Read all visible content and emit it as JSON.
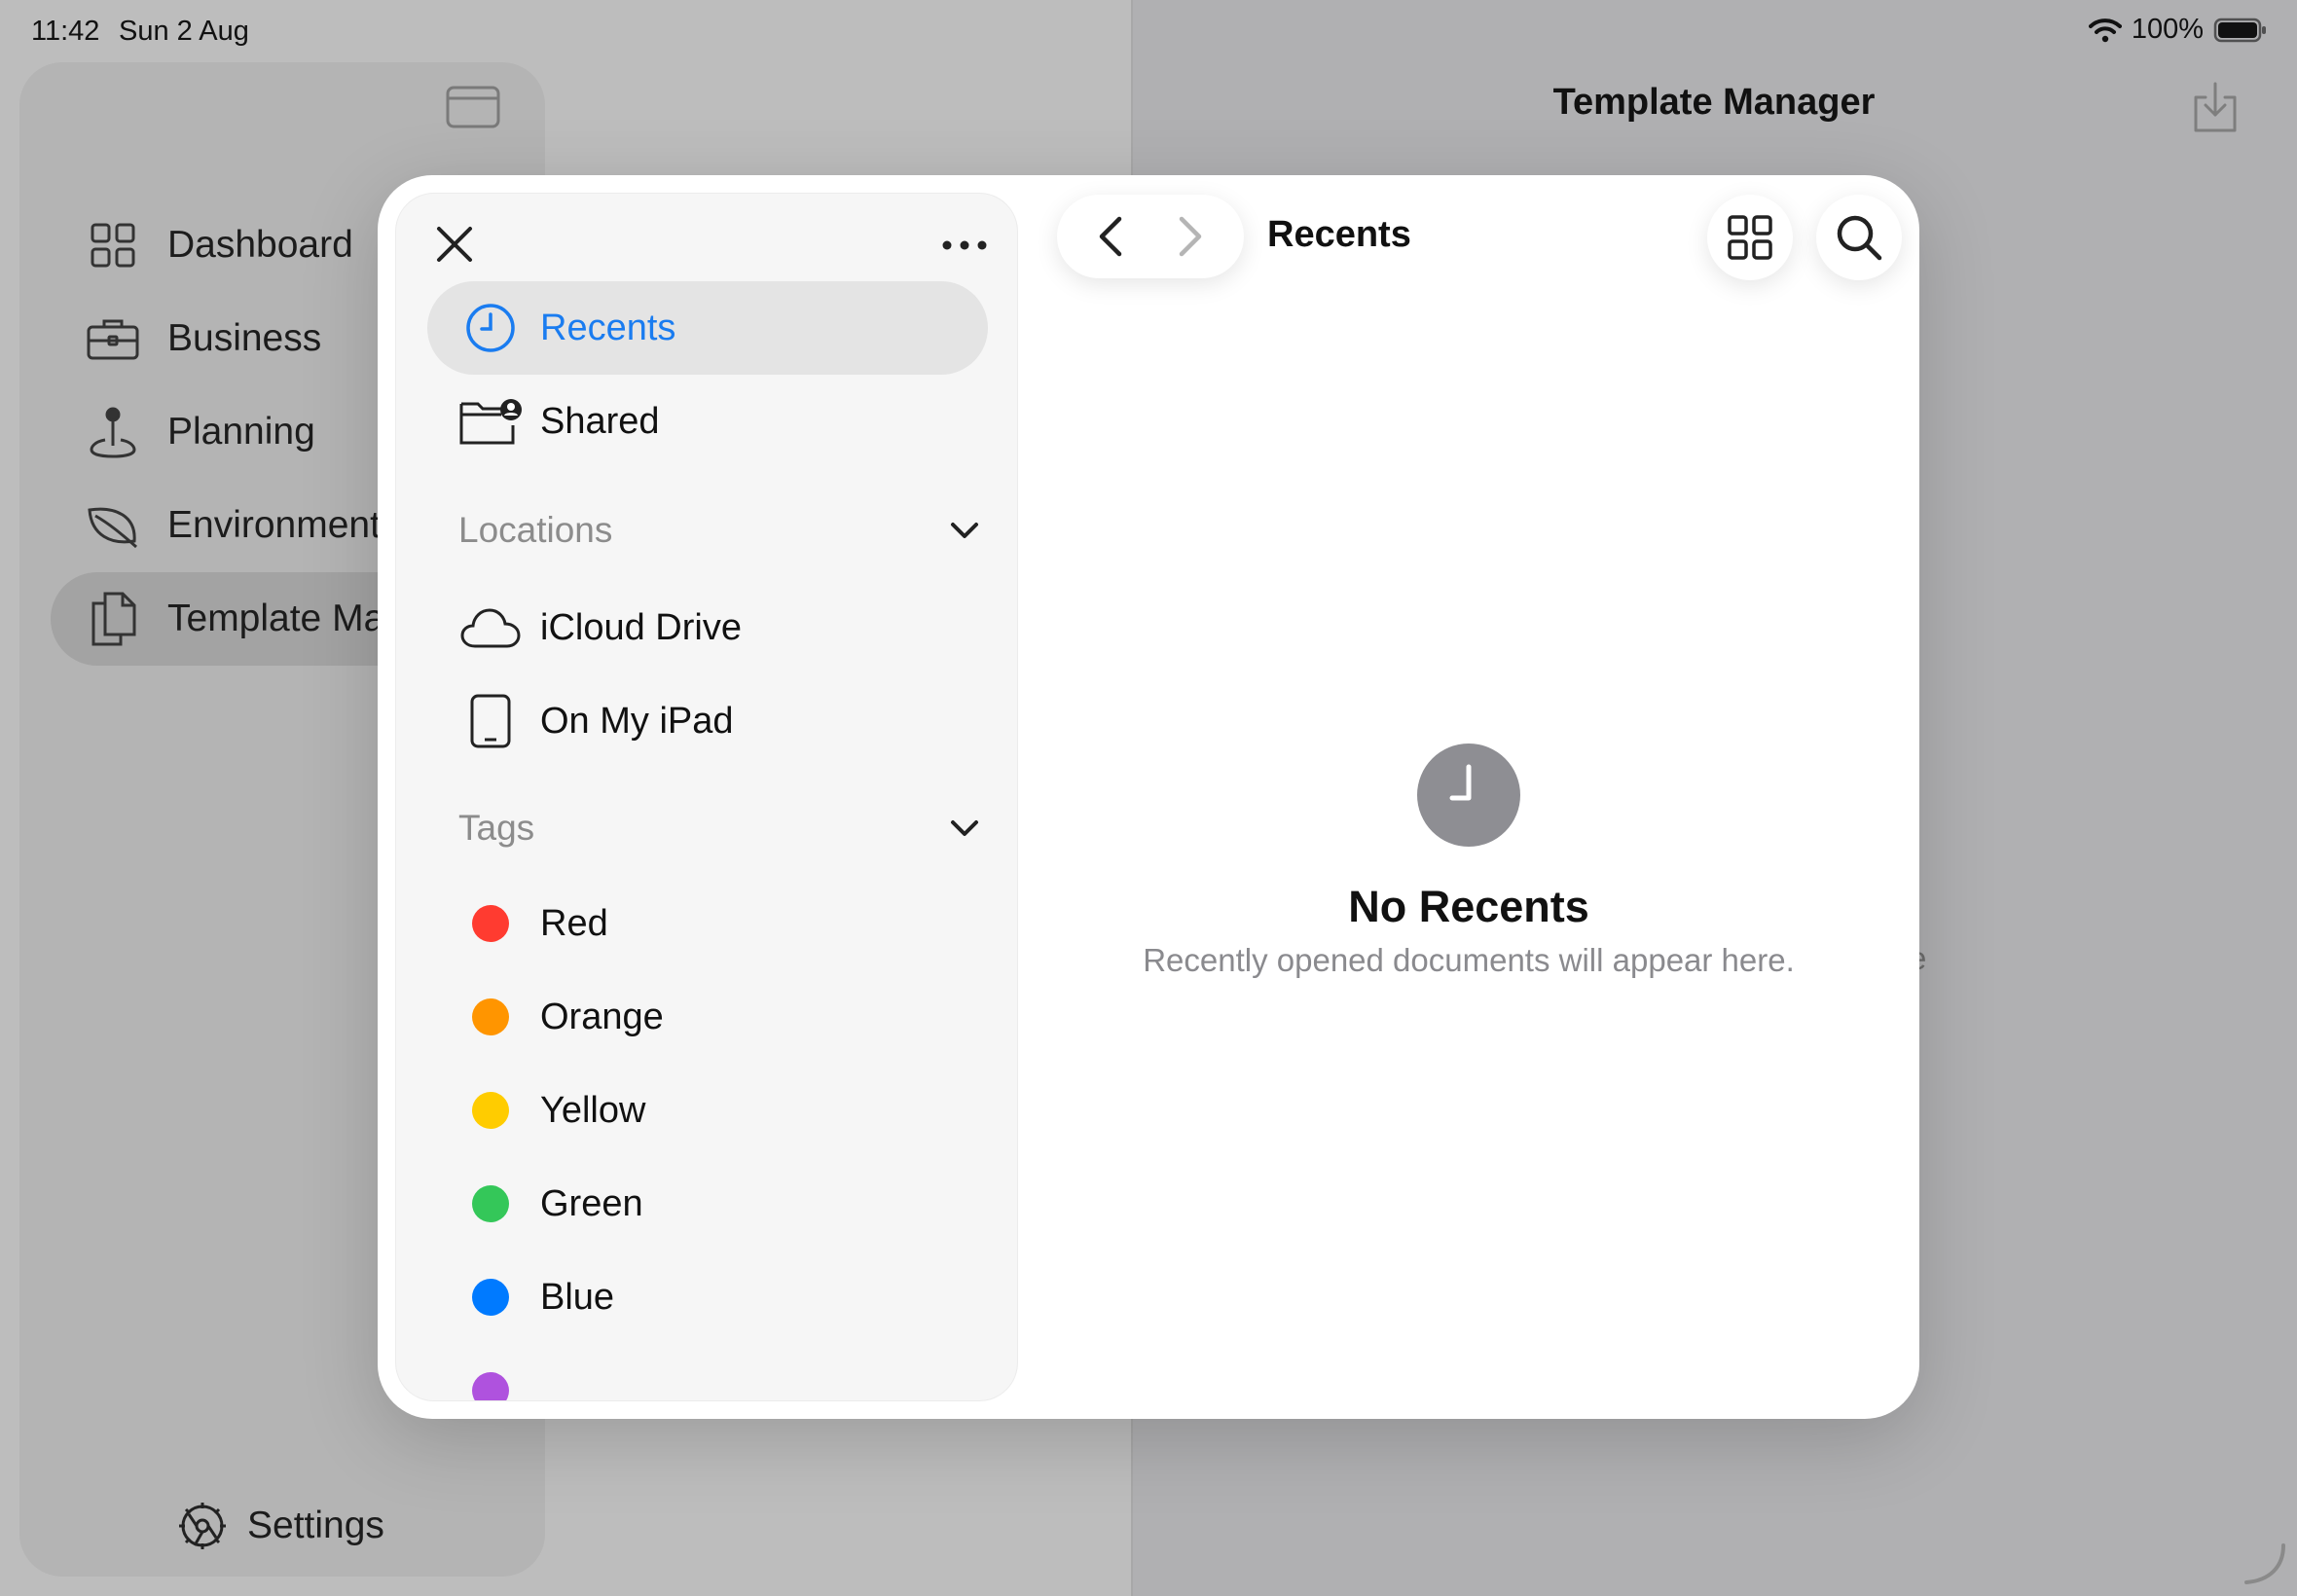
{
  "status_bar": {
    "time": "11:42",
    "date": "Sun 2 Aug",
    "battery": "100%"
  },
  "app": {
    "title": "Template Manager",
    "partial_text": "re",
    "nav_items": [
      {
        "label": "Dashboard",
        "icon": "grid-icon"
      },
      {
        "label": "Business",
        "icon": "briefcase-icon"
      },
      {
        "label": "Planning",
        "icon": "map-pin-icon"
      },
      {
        "label": "Environment",
        "icon": "leaf-icon"
      },
      {
        "label": "Template Ma",
        "icon": "documents-icon",
        "selected": true
      }
    ],
    "settings_label": "Settings"
  },
  "picker": {
    "sidebar": {
      "items": [
        {
          "label": "Recents",
          "icon": "clock-icon",
          "active": true
        },
        {
          "label": "Shared",
          "icon": "shared-folder-icon"
        }
      ],
      "locations_header": "Locations",
      "locations": [
        {
          "label": "iCloud Drive",
          "icon": "cloud-icon"
        },
        {
          "label": "On My iPad",
          "icon": "ipad-icon"
        }
      ],
      "tags_header": "Tags",
      "tags": [
        {
          "label": "Red",
          "color": "#ff3b30"
        },
        {
          "label": "Orange",
          "color": "#ff9500"
        },
        {
          "label": "Yellow",
          "color": "#ffcc00"
        },
        {
          "label": "Green",
          "color": "#34c759"
        },
        {
          "label": "Blue",
          "color": "#007aff"
        }
      ],
      "partial_tag_color": "#af52de"
    },
    "title": "Recents",
    "empty_state": {
      "title": "No Recents",
      "subtitle": "Recently opened documents will appear here."
    }
  },
  "colors": {
    "accent": "#1a7cf0"
  }
}
